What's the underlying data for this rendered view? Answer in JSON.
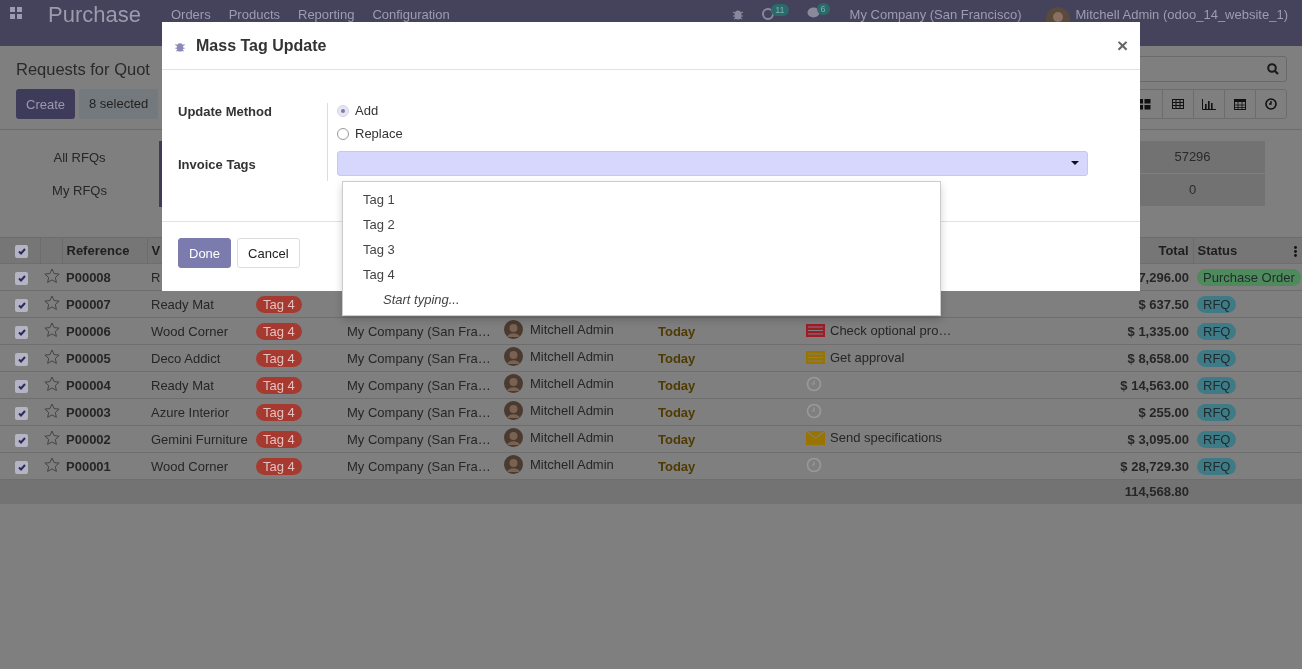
{
  "navbar": {
    "app_name": "Purchase",
    "menus": [
      "Orders",
      "Products",
      "Reporting",
      "Configuration"
    ],
    "activity_count": "11",
    "message_count": "6",
    "company": "My Company (San Francisco)",
    "user": "Mitchell Admin (odoo_14_website_1)"
  },
  "control_panel": {
    "breadcrumb": "Requests for Quot",
    "create": "Create",
    "selection": "8 selected"
  },
  "dashboard": [
    {
      "label": "All RFQs",
      "value": "57296"
    },
    {
      "label": "My RFQs",
      "value": "0"
    }
  ],
  "table": {
    "header_checked": true,
    "columns": {
      "reference": "Reference",
      "vendor": "V",
      "total": "Total",
      "status": "Status"
    },
    "rows": [
      {
        "checked": true,
        "reference": "P00008",
        "vendor": "R",
        "total": "7,296.00",
        "status": {
          "label": "Purchase Order",
          "kind": "po"
        }
      },
      {
        "checked": true,
        "reference": "P00007",
        "vendor": "Ready Mat",
        "tag": "Tag 4",
        "total": "$ 637.50",
        "status": {
          "label": "RFQ",
          "kind": "rfq"
        }
      },
      {
        "checked": true,
        "reference": "P00006",
        "vendor": "Wood Corner",
        "tag": "Tag 4",
        "company": "My Company (San Fra…",
        "salesperson": "Mitchell Admin",
        "date": "Today",
        "activity": {
          "kind": "todo",
          "color": "#9c1c28",
          "text": "Check optional pro…"
        },
        "total": "$ 1,335.00",
        "status": {
          "label": "RFQ",
          "kind": "rfq"
        }
      },
      {
        "checked": true,
        "reference": "P00005",
        "vendor": "Deco Addict",
        "tag": "Tag 4",
        "company": "My Company (San Fra…",
        "salesperson": "Mitchell Admin",
        "date": "Today",
        "activity": {
          "kind": "todo",
          "color": "#9a7400",
          "text": "Get approval"
        },
        "total": "$ 8,658.00",
        "status": {
          "label": "RFQ",
          "kind": "rfq"
        }
      },
      {
        "checked": true,
        "reference": "P00004",
        "vendor": "Ready Mat",
        "tag": "Tag 4",
        "company": "My Company (San Fra…",
        "salesperson": "Mitchell Admin",
        "date": "Today",
        "activity": {
          "kind": "none"
        },
        "total": "$ 14,563.00",
        "status": {
          "label": "RFQ",
          "kind": "rfq"
        }
      },
      {
        "checked": true,
        "reference": "P00003",
        "vendor": "Azure Interior",
        "tag": "Tag 4",
        "company": "My Company (San Fra…",
        "salesperson": "Mitchell Admin",
        "date": "Today",
        "activity": {
          "kind": "none"
        },
        "total": "$ 255.00",
        "status": {
          "label": "RFQ",
          "kind": "rfq"
        }
      },
      {
        "checked": true,
        "reference": "P00002",
        "vendor": "Gemini Furniture",
        "tag": "Tag 4",
        "company": "My Company (San Fra…",
        "salesperson": "Mitchell Admin",
        "date": "Today",
        "activity": {
          "kind": "email",
          "color": "#9a7400",
          "text": "Send specifications"
        },
        "total": "$ 3,095.00",
        "status": {
          "label": "RFQ",
          "kind": "rfq"
        }
      },
      {
        "checked": true,
        "reference": "P00001",
        "vendor": "Wood Corner",
        "tag": "Tag 4",
        "company": "My Company (San Fra…",
        "salesperson": "Mitchell Admin",
        "date": "Today",
        "activity": {
          "kind": "none"
        },
        "total": "$ 28,729.30",
        "status": {
          "label": "RFQ",
          "kind": "rfq"
        }
      }
    ],
    "sum_total": "114,568.80"
  },
  "dialog": {
    "title": "Mass Tag Update",
    "close": "×",
    "method_label": "Update Method",
    "options": [
      {
        "label": "Add",
        "selected": true
      },
      {
        "label": "Replace",
        "selected": false
      }
    ],
    "tags_label": "Invoice Tags",
    "dropdown": {
      "items": [
        "Tag 1",
        "Tag 2",
        "Tag 3",
        "Tag 4"
      ],
      "hint": "Start typing..."
    },
    "buttons": [
      {
        "label": "Done",
        "kind": "primary"
      },
      {
        "label": "Cancel",
        "kind": "secondary"
      }
    ]
  }
}
